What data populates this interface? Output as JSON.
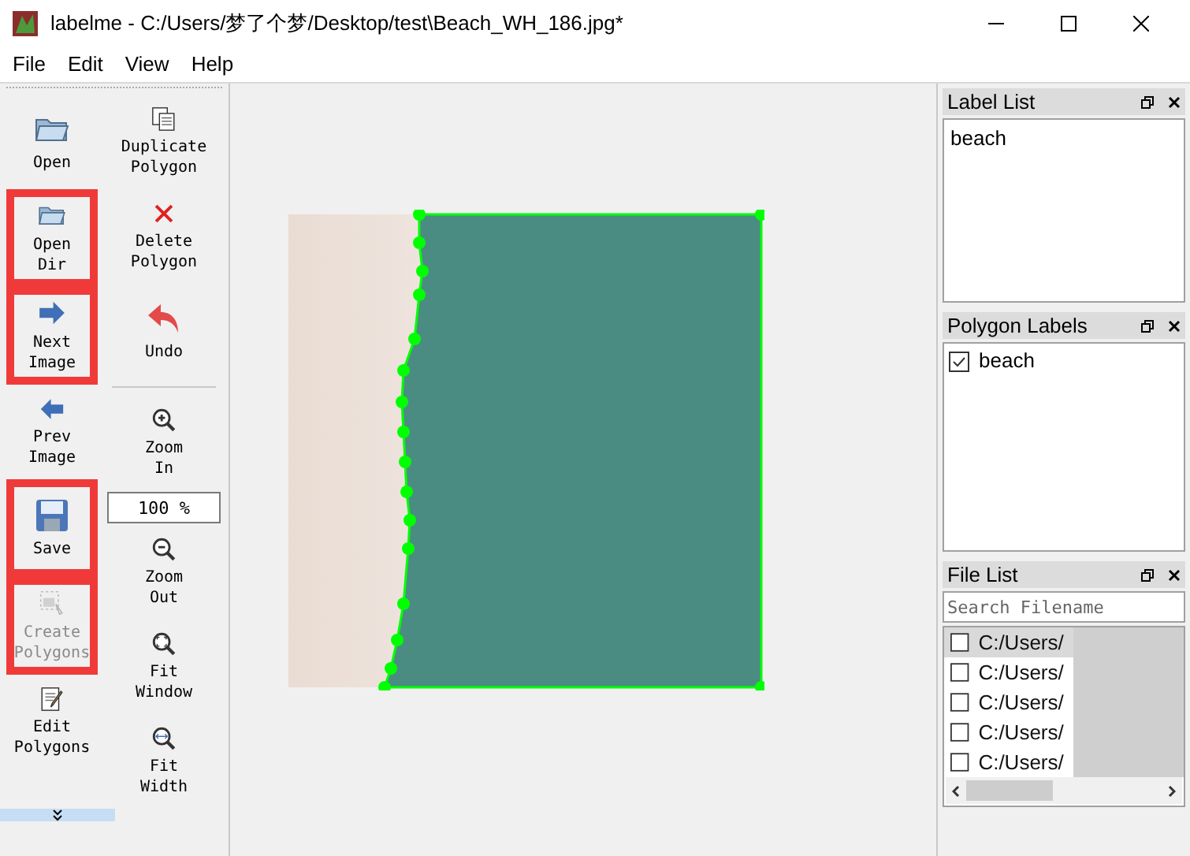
{
  "window": {
    "title": "labelme - C:/Users/梦了个梦/Desktop/test\\Beach_WH_186.jpg*"
  },
  "menu": [
    "File",
    "Edit",
    "View",
    "Help"
  ],
  "toolbar": {
    "column_1": [
      {
        "kind": "open",
        "label": "Open",
        "highlighted": false,
        "disabled": false
      },
      {
        "kind": "open",
        "label": "Open\nDir",
        "highlighted": true,
        "disabled": false
      },
      {
        "kind": "next",
        "label": "Next\nImage",
        "highlighted": true,
        "disabled": false
      },
      {
        "kind": "prev",
        "label": "Prev\nImage",
        "highlighted": false,
        "disabled": false
      },
      {
        "kind": "save",
        "label": "Save",
        "highlighted": true,
        "disabled": false
      },
      {
        "kind": "create",
        "label": "Create\nPolygons",
        "highlighted": true,
        "disabled": true
      },
      {
        "kind": "edit",
        "label": "Edit\nPolygons",
        "highlighted": false,
        "disabled": false
      }
    ],
    "column_2": [
      {
        "kind": "duplicate",
        "label": "Duplicate\nPolygon"
      },
      {
        "kind": "delete",
        "label": "Delete\nPolygon"
      },
      {
        "kind": "undo",
        "label": "Undo"
      },
      {
        "kind": "separator"
      },
      {
        "kind": "zoom_in",
        "label": "Zoom\nIn"
      },
      {
        "kind": "zoom_field",
        "value": "100 %"
      },
      {
        "kind": "zoom_out",
        "label": "Zoom\nOut"
      },
      {
        "kind": "fit_window",
        "label": "Fit\nWindow"
      },
      {
        "kind": "fit_width",
        "label": "Fit\nWidth"
      }
    ]
  },
  "label_list": {
    "title": "Label List",
    "items": [
      "beach"
    ]
  },
  "polygon_labels": {
    "title": "Polygon Labels",
    "items": [
      {
        "label": "beach",
        "checked": true
      }
    ]
  },
  "file_list": {
    "title": "File List",
    "placeholder": "Search Filename",
    "items": [
      {
        "path": "C:/Users/",
        "checked": false,
        "selected": true
      },
      {
        "path": "C:/Users/",
        "checked": false,
        "selected": false
      },
      {
        "path": "C:/Users/",
        "checked": false,
        "selected": false
      },
      {
        "path": "C:/Users/",
        "checked": false,
        "selected": false
      },
      {
        "path": "C:/Users/",
        "checked": false,
        "selected": false
      }
    ]
  }
}
